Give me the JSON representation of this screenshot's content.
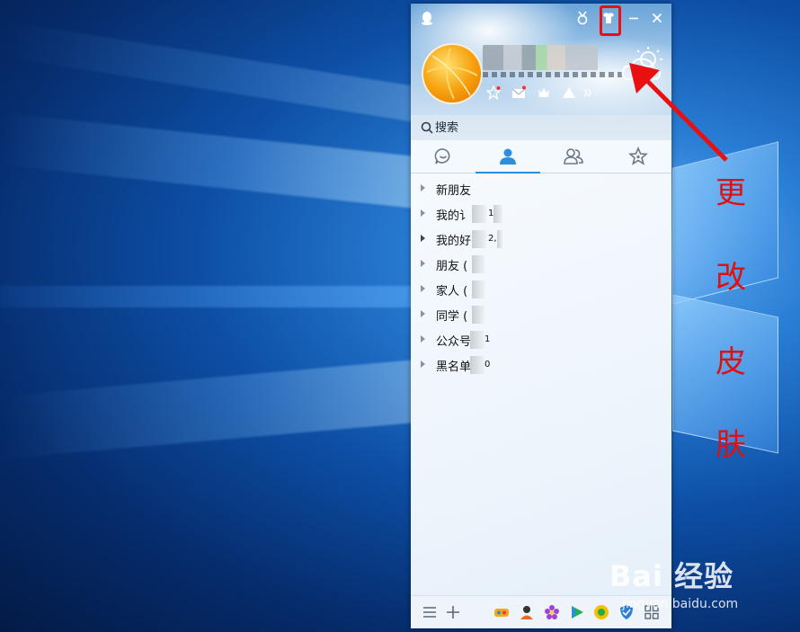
{
  "window": {
    "app": "QQ",
    "search": {
      "placeholder": "搜索"
    },
    "tabs": [
      {
        "name": "messages",
        "icon": "chat-bubble-icon",
        "active": false
      },
      {
        "name": "contacts",
        "icon": "person-icon",
        "active": true
      },
      {
        "name": "groups",
        "icon": "group-icon",
        "active": false
      },
      {
        "name": "favorites",
        "icon": "star-icon",
        "active": false
      }
    ],
    "groups": [
      {
        "label": "新朋友",
        "caret": "collapsed"
      },
      {
        "label": "我的讠",
        "count_fragment": "1",
        "caret": "collapsed"
      },
      {
        "label": "我的好",
        "count_fragment": "2,",
        "caret": "collapsed-dark"
      },
      {
        "label": "朋友 (",
        "caret": "collapsed"
      },
      {
        "label": "家人 (",
        "caret": "collapsed"
      },
      {
        "label": "同学 (",
        "caret": "collapsed"
      },
      {
        "label": "公众号",
        "count_fragment": "1",
        "caret": "collapsed"
      },
      {
        "label": "黑名单",
        "count_fragment": "0",
        "caret": "collapsed"
      }
    ],
    "colors": {
      "accent": "#2b8fde",
      "highlight": "#e81010"
    }
  },
  "annotation": {
    "chars": [
      "更",
      "改",
      "皮",
      "肤"
    ],
    "color": "#e01010"
  },
  "watermark": {
    "main": "Bai 经验",
    "sub": "jingyan.baidu.com"
  }
}
